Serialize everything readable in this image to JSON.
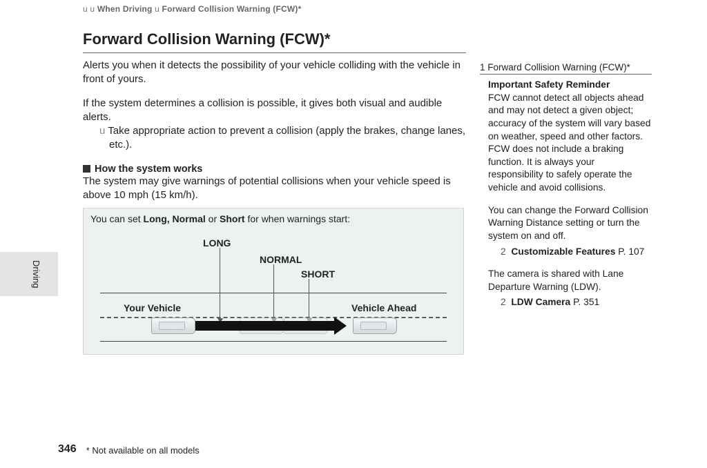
{
  "breadcrumb": {
    "symbol": "u",
    "root_symbol": "u",
    "l1": "When Driving",
    "sep": "u",
    "l2": "Forward Collision Warning (FCW)*"
  },
  "main": {
    "title": "Forward Collision Warning (FCW)*",
    "intro": "Alerts you when it detects the possibility of your vehicle colliding with the vehicle in front of yours.",
    "cond": "If the system determines a collision is possible, it gives both visual and audible alerts.",
    "action_symbol": "u",
    "action": "Take appropriate action to prevent a collision (apply the brakes, change lanes, etc.).",
    "subhead": "How the system works",
    "subdesc": "The system may give warnings of potential collisions when your vehicle speed is above 10 mph (15 km/h)."
  },
  "diagram": {
    "caption_pre": "You can set ",
    "caption_opts": "Long, Normal",
    "caption_or": " or ",
    "caption_short": "Short",
    "caption_post": " for when warnings start:",
    "long": "LONG",
    "normal": "NORMAL",
    "short": "SHORT",
    "your": "Your Vehicle",
    "ahead": "Vehicle Ahead"
  },
  "side": {
    "index_symbol": "1",
    "index_title": "Forward Collision Warning (FCW)*",
    "p1": "Important Safety Reminder",
    "p2": "FCW cannot detect all objects ahead and may not detect a given object; accuracy of the system will vary based on weather, speed and other factors. FCW does not include a braking function. It is always your responsibility to safely operate the vehicle and avoid collisions.",
    "p3": "You can change the Forward Collision Warning Distance setting or turn the system on and off.",
    "xref1_sym": "2",
    "xref1": "Customizable Features",
    "xref1_pg": "P. 107",
    "p4": "The camera is shared with Lane Departure Warning (LDW).",
    "xref2_sym": "2",
    "xref2": "LDW Camera",
    "xref2_pg": "P. 351"
  },
  "tab": {
    "label": "Driving"
  },
  "footer": {
    "page": "346",
    "note": "* Not available on all models"
  }
}
